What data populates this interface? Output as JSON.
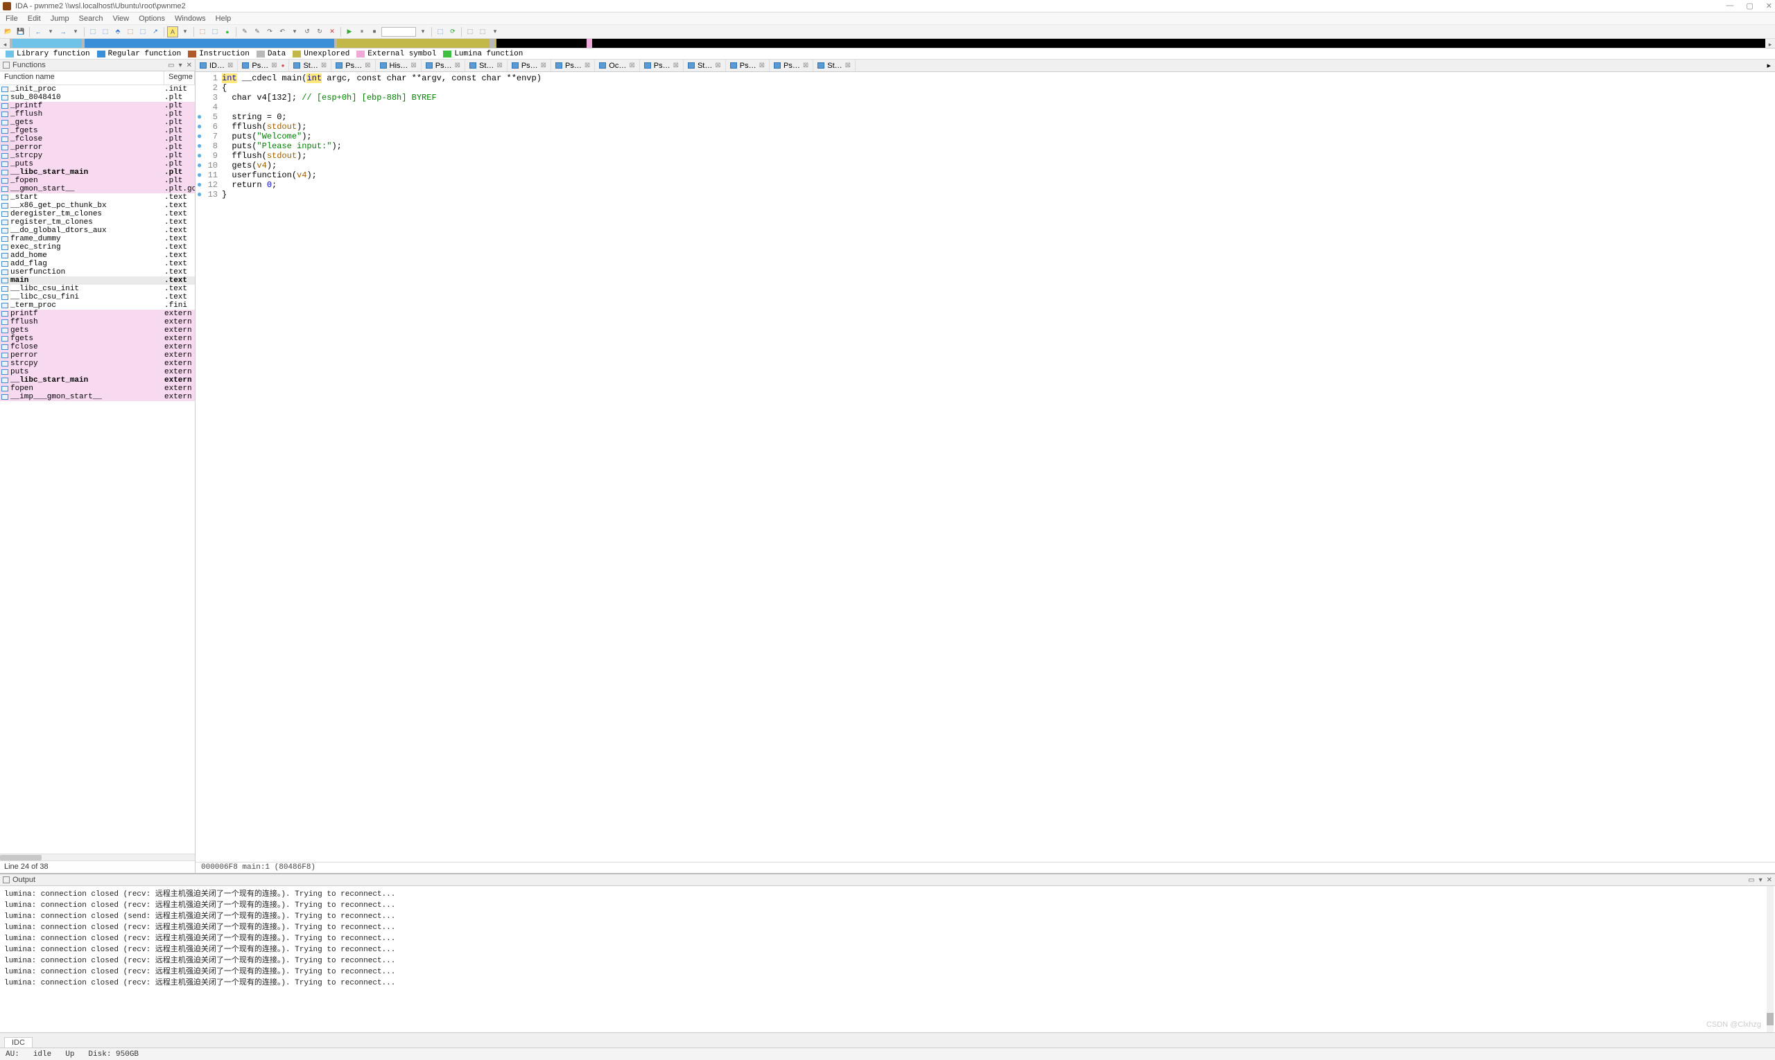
{
  "window": {
    "title": "IDA - pwnme2 \\\\wsl.localhost\\Ubuntu\\root\\pwnme2"
  },
  "menu": [
    "File",
    "Edit",
    "Jump",
    "Search",
    "View",
    "Options",
    "Windows",
    "Help"
  ],
  "legend": [
    {
      "color": "#6fc2e8",
      "label": "Library function"
    },
    {
      "color": "#3a8fd8",
      "label": "Regular function"
    },
    {
      "color": "#b05a2a",
      "label": "Instruction"
    },
    {
      "color": "#b8b8b8",
      "label": "Data"
    },
    {
      "color": "#c2b84a",
      "label": "Unexplored"
    },
    {
      "color": "#f0a8d8",
      "label": "External symbol"
    },
    {
      "color": "#3fbf3f",
      "label": "Lumina function"
    }
  ],
  "funcpanel": {
    "title": "Functions",
    "col1": "Function name",
    "col2": "Segme",
    "footer": "Line 24 of 38",
    "rows": [
      {
        "name": "_init_proc",
        "seg": ".init",
        "pink": false
      },
      {
        "name": "sub_8048410",
        "seg": ".plt",
        "pink": false
      },
      {
        "name": "_printf",
        "seg": ".plt",
        "pink": true
      },
      {
        "name": "_fflush",
        "seg": ".plt",
        "pink": true
      },
      {
        "name": "_gets",
        "seg": ".plt",
        "pink": true
      },
      {
        "name": "_fgets",
        "seg": ".plt",
        "pink": true
      },
      {
        "name": "_fclose",
        "seg": ".plt",
        "pink": true
      },
      {
        "name": "_perror",
        "seg": ".plt",
        "pink": true
      },
      {
        "name": "_strcpy",
        "seg": ".plt",
        "pink": true
      },
      {
        "name": "_puts",
        "seg": ".plt",
        "pink": true
      },
      {
        "name": "__libc_start_main",
        "seg": ".plt",
        "pink": true,
        "bold": true
      },
      {
        "name": "_fopen",
        "seg": ".plt",
        "pink": true
      },
      {
        "name": "__gmon_start__",
        "seg": ".plt.go",
        "pink": true
      },
      {
        "name": "_start",
        "seg": ".text",
        "pink": false
      },
      {
        "name": "__x86_get_pc_thunk_bx",
        "seg": ".text",
        "pink": false
      },
      {
        "name": "deregister_tm_clones",
        "seg": ".text",
        "pink": false
      },
      {
        "name": "register_tm_clones",
        "seg": ".text",
        "pink": false
      },
      {
        "name": "__do_global_dtors_aux",
        "seg": ".text",
        "pink": false
      },
      {
        "name": "frame_dummy",
        "seg": ".text",
        "pink": false
      },
      {
        "name": "exec_string",
        "seg": ".text",
        "pink": false
      },
      {
        "name": "add_home",
        "seg": ".text",
        "pink": false
      },
      {
        "name": "add_flag",
        "seg": ".text",
        "pink": false
      },
      {
        "name": "userfunction",
        "seg": ".text",
        "pink": false
      },
      {
        "name": "main",
        "seg": ".text",
        "pink": false,
        "sel": true,
        "bold": true
      },
      {
        "name": "__libc_csu_init",
        "seg": ".text",
        "pink": false
      },
      {
        "name": "__libc_csu_fini",
        "seg": ".text",
        "pink": false
      },
      {
        "name": "_term_proc",
        "seg": ".fini",
        "pink": false
      },
      {
        "name": "printf",
        "seg": "extern",
        "pink": true
      },
      {
        "name": "fflush",
        "seg": "extern",
        "pink": true
      },
      {
        "name": "gets",
        "seg": "extern",
        "pink": true
      },
      {
        "name": "fgets",
        "seg": "extern",
        "pink": true
      },
      {
        "name": "fclose",
        "seg": "extern",
        "pink": true
      },
      {
        "name": "perror",
        "seg": "extern",
        "pink": true
      },
      {
        "name": "strcpy",
        "seg": "extern",
        "pink": true
      },
      {
        "name": "puts",
        "seg": "extern",
        "pink": true
      },
      {
        "name": "__libc_start_main",
        "seg": "extern",
        "pink": true,
        "bold": true
      },
      {
        "name": "fopen",
        "seg": "extern",
        "pink": true
      },
      {
        "name": "__imp___gmon_start__",
        "seg": "extern",
        "pink": true
      }
    ]
  },
  "tabs": [
    {
      "label": "ID…",
      "dot": false
    },
    {
      "label": "Ps…",
      "dot": true
    },
    {
      "label": "St…",
      "dot": false
    },
    {
      "label": "Ps…",
      "dot": false
    },
    {
      "label": "His…",
      "dot": false
    },
    {
      "label": "Ps…",
      "dot": false
    },
    {
      "label": "St…",
      "dot": false
    },
    {
      "label": "Ps…",
      "dot": false
    },
    {
      "label": "Ps…",
      "dot": false
    },
    {
      "label": "Oc…",
      "dot": false
    },
    {
      "label": "Ps…",
      "dot": false
    },
    {
      "label": "St…",
      "dot": false
    },
    {
      "label": "Ps…",
      "dot": false
    },
    {
      "label": "Ps…",
      "dot": false
    },
    {
      "label": "St…",
      "dot": false
    }
  ],
  "code": {
    "status": "000006F8 main:1 (80486F8)",
    "lines": [
      {
        "n": 1,
        "dot": false
      },
      {
        "n": 2,
        "dot": false
      },
      {
        "n": 3,
        "dot": false
      },
      {
        "n": 4,
        "dot": false
      },
      {
        "n": 5,
        "dot": true
      },
      {
        "n": 6,
        "dot": true
      },
      {
        "n": 7,
        "dot": true
      },
      {
        "n": 8,
        "dot": true
      },
      {
        "n": 9,
        "dot": true
      },
      {
        "n": 10,
        "dot": true
      },
      {
        "n": 11,
        "dot": true
      },
      {
        "n": 12,
        "dot": true
      },
      {
        "n": 13,
        "dot": true
      }
    ],
    "text": {
      "l1_int": "int",
      "l1_cdecl": " __cdecl main(",
      "l1_int2": "int",
      "l1_rest": " argc, const char **argv, const char **envp)",
      "l2": "{",
      "l3a": "  char v4[132]; ",
      "l3b": "// [esp+0h] [ebp-88h] BYREF",
      "l4": "",
      "l5": "  string = 0;",
      "l6a": "  fflush(",
      "l6b": "stdout",
      "l6c": ");",
      "l7a": "  puts(",
      "l7b": "\"Welcome\"",
      "l7c": ");",
      "l8a": "  puts(",
      "l8b": "\"Please input:\"",
      "l8c": ");",
      "l9a": "  fflush(",
      "l9b": "stdout",
      "l9c": ");",
      "l10a": "  gets(",
      "l10b": "v4",
      "l10c": ");",
      "l11a": "  userfunction(",
      "l11b": "v4",
      "l11c": ");",
      "l12a": "  return ",
      "l12b": "0",
      "l12c": ";",
      "l13": "}"
    }
  },
  "output": {
    "title": "Output",
    "lines": [
      "lumina: connection closed (recv: 远程主机强迫关闭了一个现有的连接。). Trying to reconnect...",
      "lumina: connection closed (recv: 远程主机强迫关闭了一个现有的连接。). Trying to reconnect...",
      "lumina: connection closed (send: 远程主机强迫关闭了一个现有的连接。). Trying to reconnect...",
      "lumina: connection closed (recv: 远程主机强迫关闭了一个现有的连接。). Trying to reconnect...",
      "lumina: connection closed (recv: 远程主机强迫关闭了一个现有的连接。). Trying to reconnect...",
      "lumina: connection closed (recv: 远程主机强迫关闭了一个现有的连接。). Trying to reconnect...",
      "lumina: connection closed (recv: 远程主机强迫关闭了一个现有的连接。). Trying to reconnect...",
      "lumina: connection closed (recv: 远程主机强迫关闭了一个现有的连接。). Trying to reconnect...",
      "lumina: connection closed (recv: 远程主机强迫关闭了一个现有的连接。). Trying to reconnect..."
    ]
  },
  "idc": "IDC",
  "status": {
    "au": "AU:",
    "idle": "idle",
    "up": "Up",
    "disk": "Disk: 950GB"
  },
  "watermark": "CSDN @Clxhzg"
}
